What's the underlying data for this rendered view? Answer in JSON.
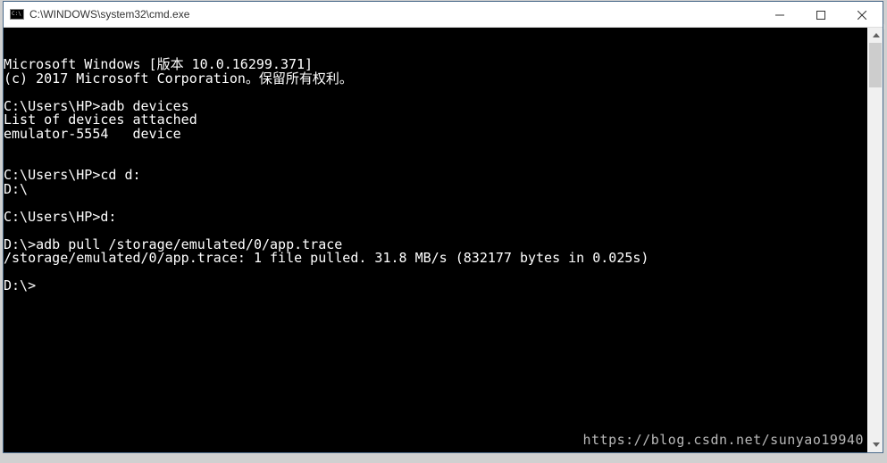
{
  "window": {
    "title": "C:\\WINDOWS\\system32\\cmd.exe"
  },
  "terminal": {
    "lines": [
      "Microsoft Windows [版本 10.0.16299.371]",
      "(c) 2017 Microsoft Corporation。保留所有权利。",
      "",
      "C:\\Users\\HP>adb devices",
      "List of devices attached",
      "emulator-5554   device",
      "",
      "",
      "C:\\Users\\HP>cd d:",
      "D:\\",
      "",
      "C:\\Users\\HP>d:",
      "",
      "D:\\>adb pull /storage/emulated/0/app.trace",
      "/storage/emulated/0/app.trace: 1 file pulled. 31.8 MB/s (832177 bytes in 0.025s)",
      "",
      "D:\\>"
    ]
  },
  "watermark": "https://blog.csdn.net/sunyao19940"
}
